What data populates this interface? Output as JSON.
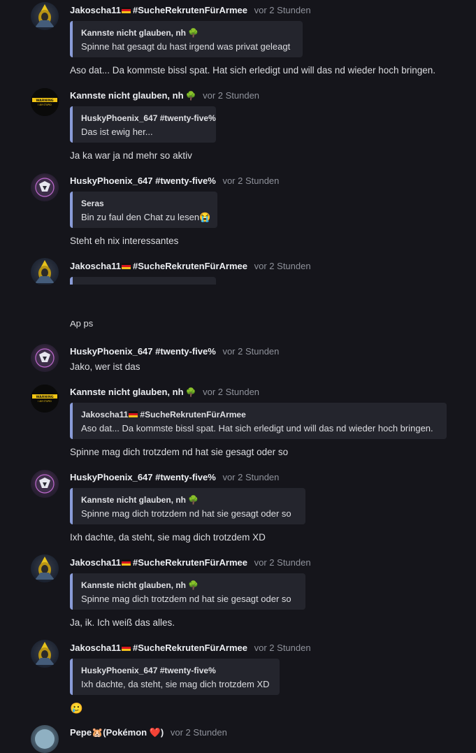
{
  "timestamp": "vor 2 Stunden",
  "users": {
    "jako": "Jakoscha11",
    "jako_tag": "#SucheRekrutenFürArmee",
    "husky": "HuskyPhoenix_647 #twenty-five%",
    "kannste": "Kannste nicht glauben, nh",
    "seras": "Seras",
    "pepe": "Pepe",
    "pepe_tag": "(Pokémon"
  },
  "warning_avatar": {
    "line1": "WARNING",
    "line2": "I AM STUPID"
  },
  "messages": [
    {
      "quote_text": "Spinne hat gesagt du hast irgend was privat geleagt",
      "text": "Aso dat... Da kommste bissl spat. Hat sich erledigt und will das nd wieder hoch bringen."
    },
    {
      "quote_text": "Das ist ewig her...",
      "text": "Ja ka war ja nd mehr so aktiv"
    },
    {
      "quote_text": "Bin zu faul den Chat zu lesen😭",
      "text": "Steht eh nix interessantes"
    },
    {
      "partial_text": "Ap ps"
    },
    {
      "text": "Jako, wer ist das"
    },
    {
      "quote_text": "Aso dat... Da kommste bissl spat. Hat sich erledigt und will das nd wieder hoch bringen.",
      "text": "Spinne mag dich trotzdem nd hat sie gesagt oder so"
    },
    {
      "quote_text": "Spinne mag dich trotzdem nd hat sie gesagt oder so",
      "text": "Ixh dachte, da steht, sie mag dich trotzdem XD"
    },
    {
      "quote_text": "Spinne mag dich trotzdem nd hat sie gesagt oder so",
      "text": "Ja, ik. Ich weiß das alles."
    },
    {
      "quote_text": "Ixh dachte, da steht, sie mag dich trotzdem XD",
      "text": "🥲"
    }
  ],
  "icons": {
    "tree": "🌳",
    "pepe_emoji": "🐹",
    "heart": "❤️"
  }
}
